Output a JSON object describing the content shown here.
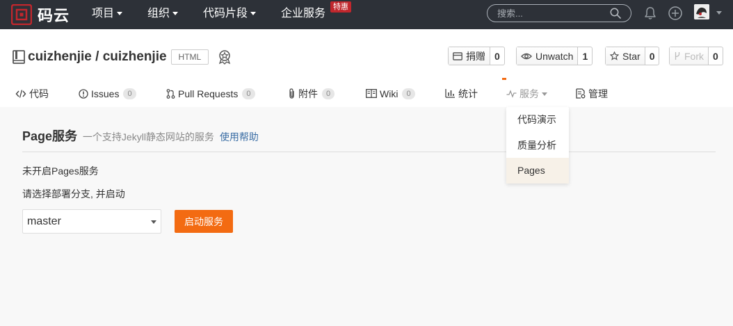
{
  "topbar": {
    "logo_text": "码云",
    "nav": [
      {
        "label": "项目",
        "has_caret": true
      },
      {
        "label": "组织",
        "has_caret": true
      },
      {
        "label": "代码片段",
        "has_caret": true
      },
      {
        "label": "企业服务",
        "has_caret": false
      }
    ],
    "hot_badge": "特惠",
    "search_placeholder": "搜索...",
    "icons": [
      "search-icon",
      "bell-icon",
      "plus-circle-icon",
      "avatar"
    ]
  },
  "repo": {
    "name": "cuizhenjie / cuizhenjie",
    "language": "HTML",
    "buttons": {
      "donate": {
        "label": "捐赠",
        "count": "0"
      },
      "unwatch": {
        "label": "Unwatch",
        "count": "1"
      },
      "star": {
        "label": "Star",
        "count": "0"
      },
      "fork": {
        "label": "Fork",
        "count": "0"
      }
    }
  },
  "tabs": [
    {
      "label": "代码",
      "icon": "code-icon",
      "count": null
    },
    {
      "label": "Issues",
      "icon": "issue-icon",
      "count": "0"
    },
    {
      "label": "Pull Requests",
      "icon": "pull-request-icon",
      "count": "0"
    },
    {
      "label": "附件",
      "icon": "paperclip-icon",
      "count": "0"
    },
    {
      "label": "Wiki",
      "icon": "wiki-icon",
      "count": "0"
    },
    {
      "label": "统计",
      "icon": "bar-chart-icon",
      "count": null
    },
    {
      "label": "服务",
      "icon": "pulse-icon",
      "count": null
    },
    {
      "label": "管理",
      "icon": "settings-doc-icon",
      "count": null
    }
  ],
  "dropdown": {
    "items": [
      "代码演示",
      "质量分析",
      "Pages"
    ],
    "highlighted": "Pages"
  },
  "main": {
    "title": "Page服务",
    "description": "一个支持Jekyll静态网站的服务",
    "help_link": "使用帮助",
    "status": "未开启Pages服务",
    "hint": "请选择部署分支, 并启动",
    "branch": "master",
    "start_button": "启动服务"
  },
  "colors": {
    "topbar_bg": "#2d3138",
    "accent": "#f36b12",
    "brand_red": "#c1272d",
    "link": "#3b6ea5"
  }
}
